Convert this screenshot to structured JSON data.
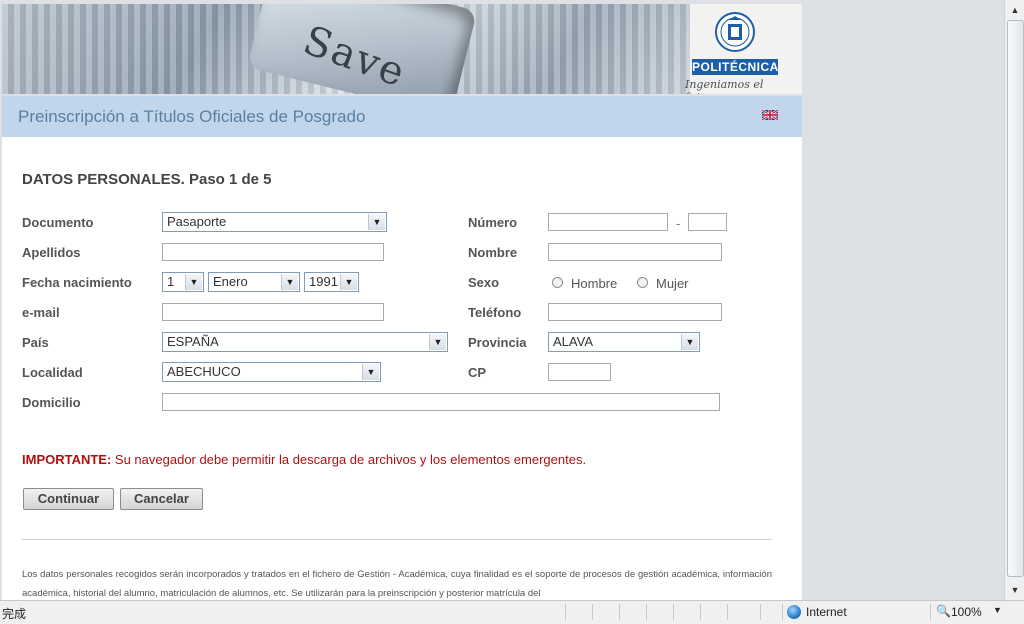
{
  "banner": {
    "key_text": "Save",
    "brand": "POLITÉCNICA",
    "slogan": "Ingeniamos el futuro"
  },
  "header": {
    "title": "Preinscripción a Títulos Oficiales de Posgrado",
    "language_icon": "uk-flag-icon"
  },
  "form": {
    "step_title": "DATOS PERSONALES. Paso 1 de 5",
    "documento_label": "Documento",
    "documento_value": "Pasaporte",
    "numero_label": "Número",
    "numero_separator": "-",
    "apellidos_label": "Apellidos",
    "nombre_label": "Nombre",
    "fecha_label": "Fecha nacimiento",
    "fecha_dia": "1",
    "fecha_mes": "Enero",
    "fecha_anio": "1991",
    "sexo_label": "Sexo",
    "sexo_hombre": "Hombre",
    "sexo_mujer": "Mujer",
    "email_label": "e-mail",
    "telefono_label": "Teléfono",
    "pais_label": "País",
    "pais_value": "ESPAÑA",
    "provincia_label": "Provincia",
    "provincia_value": "ALAVA",
    "localidad_label": "Localidad",
    "localidad_value": "ABECHUCO",
    "cp_label": "CP",
    "domicilio_label": "Domicilio"
  },
  "notice": {
    "prefix": "IMPORTANTE:",
    "text": " Su navegador debe permitir la descarga de archivos y los elementos emergentes."
  },
  "buttons": {
    "continuar": "Continuar",
    "cancelar": "Cancelar"
  },
  "legal_text": "Los datos personales recogidos serán incorporados y tratados en el fichero de Gestión - Académica, cuya finalidad es el soporte de procesos de gestión académica, información académica, historial del alumno, matriculación de alumnos, etc. Se utilizarán para la preinscripción y posterior matrícula del",
  "statusbar": {
    "status_text": "完成",
    "zone": "Internet",
    "zoom": "100%"
  }
}
